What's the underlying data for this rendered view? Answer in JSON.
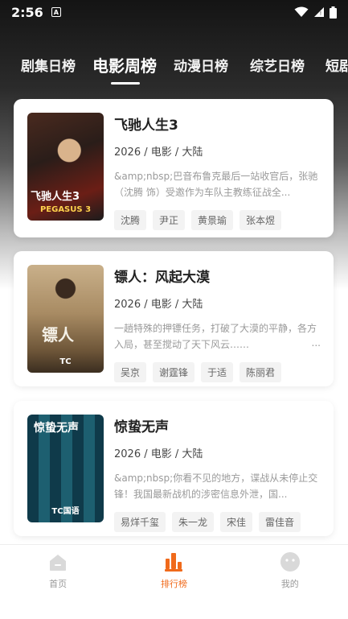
{
  "status": {
    "time": "2:56",
    "app_icon": "A"
  },
  "tabs": [
    {
      "label": "剧集日榜"
    },
    {
      "label": "电影周榜"
    },
    {
      "label": "动漫日榜"
    },
    {
      "label": "综艺日榜"
    },
    {
      "label": "短剧"
    }
  ],
  "movies": [
    {
      "title": "飞驰人生3",
      "meta": "2026 / 电影 / 大陆",
      "desc": "&amp;nbsp;巴音布鲁克最后一站收官后，张驰（沈腾 饰）受邀作为车队主教练征战全...",
      "cast": [
        "沈腾",
        "尹正",
        "黄景瑜",
        "张本煜"
      ],
      "poster_title": "飞驰人生3",
      "poster_label": "PEGASUS 3"
    },
    {
      "title": "镖人：风起大漠",
      "meta": "2026 / 电影 / 大陆",
      "desc": "一趟特殊的押镖任务，打破了大漠的平静，各方入局，甚至搅动了天下风云……",
      "more": "...",
      "cast": [
        "吴京",
        "谢霆锋",
        "于适",
        "陈丽君"
      ],
      "poster_title": "镖人",
      "poster_label": "TC"
    },
    {
      "title": "惊蛰无声",
      "meta": "2026 / 电影 / 大陆",
      "desc": "&amp;nbsp;你看不见的地方，谍战从未停止交锋！我国最新战机的涉密信息外泄，国...",
      "cast": [
        "易烊千玺",
        "朱一龙",
        "宋佳",
        "雷佳音"
      ],
      "poster_title": "惊蛰无声",
      "poster_label": "TC国语"
    }
  ],
  "nav": [
    {
      "label": "首页",
      "icon": "home-icon"
    },
    {
      "label": "排行榜",
      "icon": "ranking-icon"
    },
    {
      "label": "我的",
      "icon": "profile-icon"
    }
  ],
  "colors": {
    "accent": "#f06a1b"
  }
}
